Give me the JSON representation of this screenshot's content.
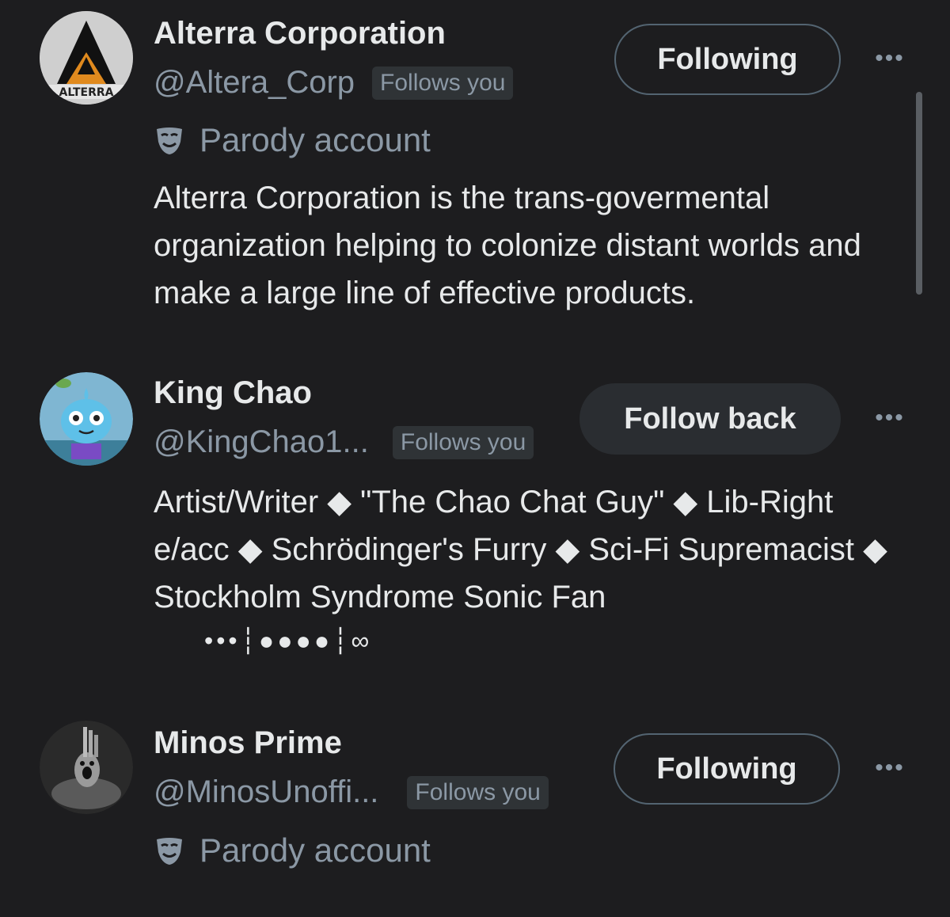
{
  "users": [
    {
      "name": "Alterra Corporation",
      "handle": "@Altera_Corp",
      "follows_badge": "Follows you",
      "button": "Following",
      "parody_label": "Parody account",
      "avatar_text": "ALTERRA",
      "bio": "Alterra Corporation is the trans-govermental organization helping to colonize distant worlds and make a large line of effective products."
    },
    {
      "name": "King Chao",
      "handle": "@KingChao1...",
      "follows_badge": "Follows you",
      "button": "Follow back",
      "bio": "Artist/Writer ◆ \"The Chao Chat Guy\" ◆ Lib-Right e/acc ◆ Schrödinger's Furry ◆ Sci-Fi Supremacist ◆ Stockholm Syndrome Sonic Fan",
      "bio_extra": "•••┆●●●●┆∞"
    },
    {
      "name": "Minos Prime",
      "handle": "@MinosUnoffi...",
      "follows_badge": "Follows you",
      "button": "Following",
      "parody_label": "Parody account"
    }
  ],
  "more_icon": "more-horizontal-icon",
  "parody_icon": "mask-icon",
  "colors": {
    "background": "#1d1d1f",
    "primary_text": "#e7e9ea",
    "secondary_text": "#8b98a5",
    "badge_bg": "#2f3336",
    "follow_back_bg": "#2a2d31"
  }
}
